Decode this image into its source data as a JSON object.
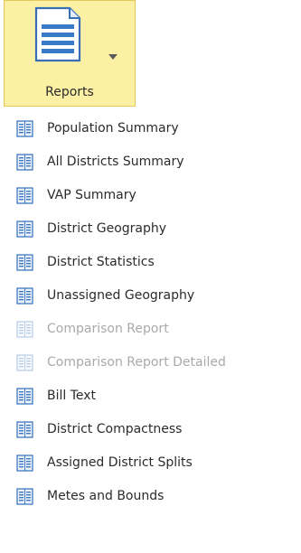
{
  "ribbon": {
    "reports_button_label": "Reports",
    "button_icon": "report-document-icon",
    "dropdown_icon": "dropdown-arrow-icon"
  },
  "colors": {
    "button_background": "#fbf0a3",
    "text": "#2b2b2b",
    "disabled_text": "#a9a9a9",
    "icon_blue": "#3f78c3"
  },
  "menu": {
    "item_icon": "report-page-icon",
    "items": [
      {
        "label": "Population Summary",
        "enabled": true
      },
      {
        "label": "All Districts Summary",
        "enabled": true
      },
      {
        "label": "VAP Summary",
        "enabled": true
      },
      {
        "label": "District Geography",
        "enabled": true
      },
      {
        "label": "District Statistics",
        "enabled": true
      },
      {
        "label": "Unassigned Geography",
        "enabled": true
      },
      {
        "label": "Comparison Report",
        "enabled": false
      },
      {
        "label": "Comparison Report Detailed",
        "enabled": false
      },
      {
        "label": "Bill Text",
        "enabled": true
      },
      {
        "label": "District Compactness",
        "enabled": true
      },
      {
        "label": "Assigned District Splits",
        "enabled": true
      },
      {
        "label": "Metes and Bounds",
        "enabled": true
      }
    ]
  }
}
